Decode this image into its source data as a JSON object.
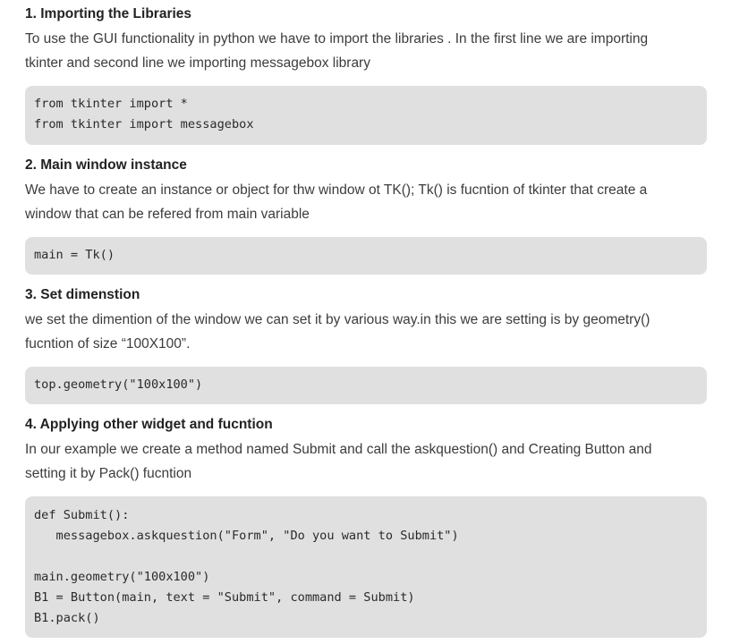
{
  "sections": [
    {
      "heading": "1. Importing the Libraries",
      "text_lines": [
        "To use the GUI functionality in python we have to import the libraries . In the first line we are importing",
        "tkinter and second line we importing messagebox library"
      ],
      "code": [
        "from tkinter import *",
        "from tkinter import messagebox"
      ]
    },
    {
      "heading": "2. Main window instance",
      "text_lines": [
        "We have to create an instance or object for thw window ot TK(); Tk() is fucntion of tkinter that create a",
        "window that can be refered from main variable"
      ],
      "code": [
        "main = Tk()"
      ]
    },
    {
      "heading": "3. Set dimenstion",
      "text_lines": [
        "we set the dimention of the window we can set it by various way.in this we are setting is by geometry()",
        "fucntion of size “100X100”."
      ],
      "code": [
        "top.geometry(\"100x100\")"
      ]
    },
    {
      "heading": "4. Applying other widget and fucntion",
      "text_lines": [
        "In our example we create a method named Submit and call the askquestion() and Creating Button and",
        "setting it by Pack() fucntion"
      ],
      "code": [
        "def Submit():",
        "   messagebox.askquestion(\"Form\", \"Do you want to Submit\")",
        "",
        "main.geometry(\"100x100\")",
        "B1 = Button(main, text = \"Submit\", command = Submit)",
        "B1.pack()"
      ]
    }
  ]
}
